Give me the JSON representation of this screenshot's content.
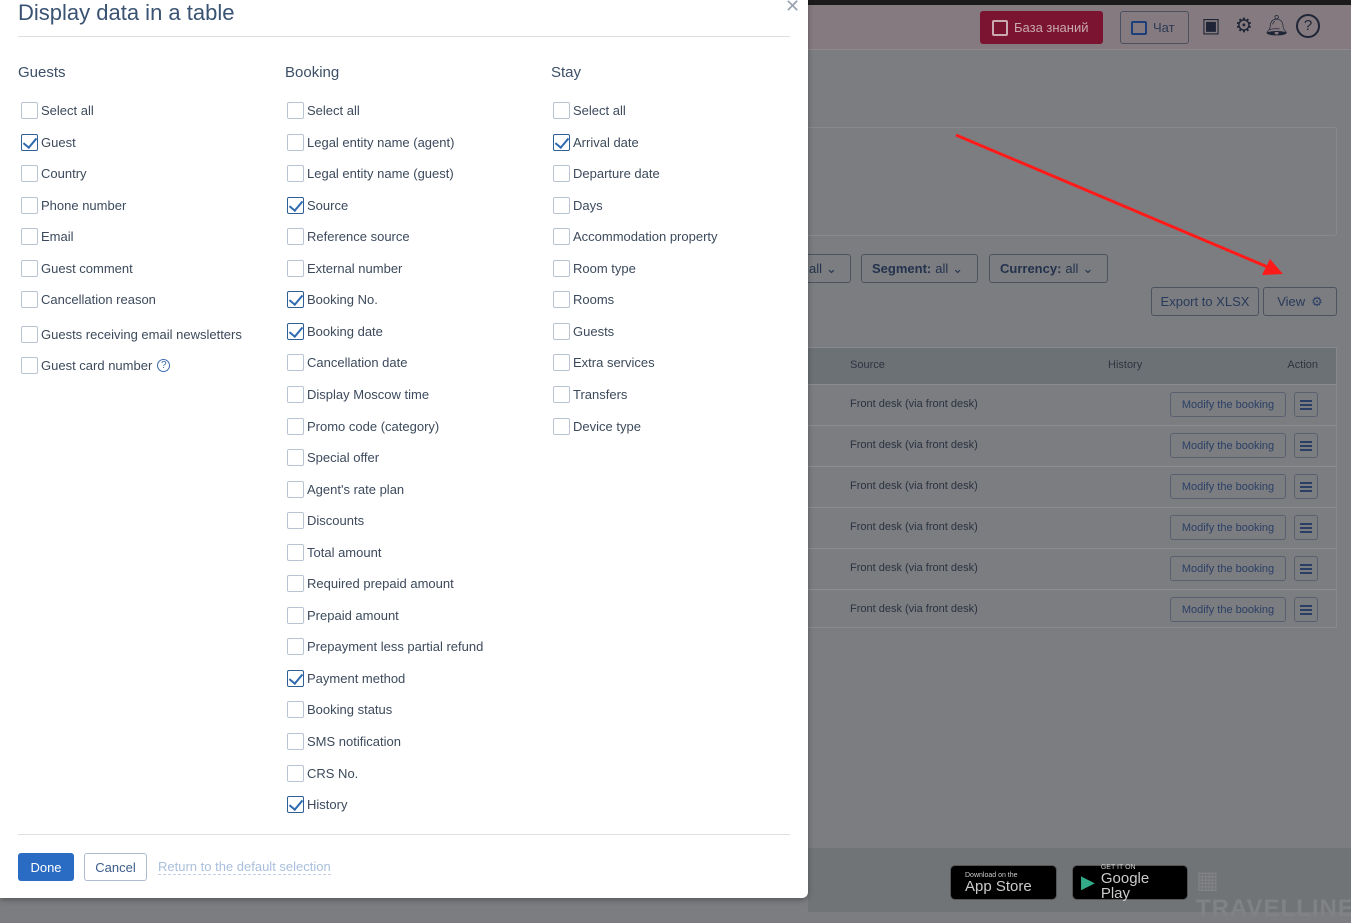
{
  "modal": {
    "title": "Display data in a table",
    "close_icon": "close-icon",
    "columns": [
      {
        "heading": "Guests",
        "items": [
          {
            "label": "Select all",
            "checked": false
          },
          {
            "label": "Guest",
            "checked": true
          },
          {
            "label": "Country",
            "checked": false
          },
          {
            "label": "Phone number",
            "checked": false
          },
          {
            "label": "Email",
            "checked": false
          },
          {
            "label": "Guest comment",
            "checked": false
          },
          {
            "label": "Cancellation reason",
            "checked": false
          },
          {
            "label": "Guests receiving email newsletters",
            "checked": false
          },
          {
            "label": "Guest card number",
            "checked": false,
            "help": "?"
          }
        ]
      },
      {
        "heading": "Booking",
        "items": [
          {
            "label": "Select all",
            "checked": false
          },
          {
            "label": "Legal entity name (agent)",
            "checked": false
          },
          {
            "label": "Legal entity name (guest)",
            "checked": false
          },
          {
            "label": "Source",
            "checked": true
          },
          {
            "label": "Reference source",
            "checked": false
          },
          {
            "label": "External number",
            "checked": false
          },
          {
            "label": "Booking No.",
            "checked": true
          },
          {
            "label": "Booking date",
            "checked": true
          },
          {
            "label": "Cancellation date",
            "checked": false
          },
          {
            "label": "Display Moscow time",
            "checked": false
          },
          {
            "label": "Promo code (category)",
            "checked": false
          },
          {
            "label": "Special offer",
            "checked": false
          },
          {
            "label": "Agent's rate plan",
            "checked": false
          },
          {
            "label": "Discounts",
            "checked": false
          },
          {
            "label": "Total amount",
            "checked": false
          },
          {
            "label": "Required prepaid amount",
            "checked": false
          },
          {
            "label": "Prepaid amount",
            "checked": false
          },
          {
            "label": "Prepayment less partial refund",
            "checked": false
          },
          {
            "label": "Payment method",
            "checked": true
          },
          {
            "label": "Booking status",
            "checked": false
          },
          {
            "label": "SMS notification",
            "checked": false
          },
          {
            "label": "CRS No.",
            "checked": false
          },
          {
            "label": "History",
            "checked": true
          }
        ]
      },
      {
        "heading": "Stay",
        "items": [
          {
            "label": "Select all",
            "checked": false
          },
          {
            "label": "Arrival date",
            "checked": true
          },
          {
            "label": "Departure date",
            "checked": false
          },
          {
            "label": "Days",
            "checked": false
          },
          {
            "label": "Accommodation property",
            "checked": false
          },
          {
            "label": "Room type",
            "checked": false
          },
          {
            "label": "Rooms",
            "checked": false
          },
          {
            "label": "Guests",
            "checked": false
          },
          {
            "label": "Extra services",
            "checked": false
          },
          {
            "label": "Transfers",
            "checked": false
          },
          {
            "label": "Device type",
            "checked": false
          }
        ]
      }
    ],
    "done_label": "Done",
    "cancel_label": "Cancel",
    "reset_label": "Return to the default selection"
  },
  "background": {
    "header": {
      "knowledge_base": "База знаний",
      "chat": "Чат"
    },
    "filters": [
      {
        "key": "",
        "value": "all"
      },
      {
        "key": "Segment:",
        "value": "all"
      },
      {
        "key": "Currency:",
        "value": "all"
      }
    ],
    "export_label": "Export to XLSX",
    "view_label": "View",
    "table": {
      "headers": [
        "Source",
        "History",
        "Action"
      ],
      "rows": [
        {
          "source": "Front desk (via front desk)",
          "action": "Modify the booking"
        },
        {
          "source": "Front desk (via front desk)",
          "action": "Modify the booking"
        },
        {
          "source": "Front desk (via front desk)",
          "action": "Modify the booking"
        },
        {
          "source": "Front desk (via front desk)",
          "action": "Modify the booking"
        },
        {
          "source": "Front desk (via front desk)",
          "action": "Modify the booking"
        },
        {
          "source": "Front desk (via front desk)",
          "action": "Modify the booking"
        }
      ]
    },
    "footer": {
      "app_store_small": "Download on the",
      "app_store": "App Store",
      "google_small": "GET IT ON",
      "google": "Google Play",
      "brand": "TRAVELLINE"
    }
  },
  "colors": {
    "accent": "#2a6cc4",
    "knowledge_base": "#7a1430",
    "annotation_arrow": "#ff0000"
  }
}
